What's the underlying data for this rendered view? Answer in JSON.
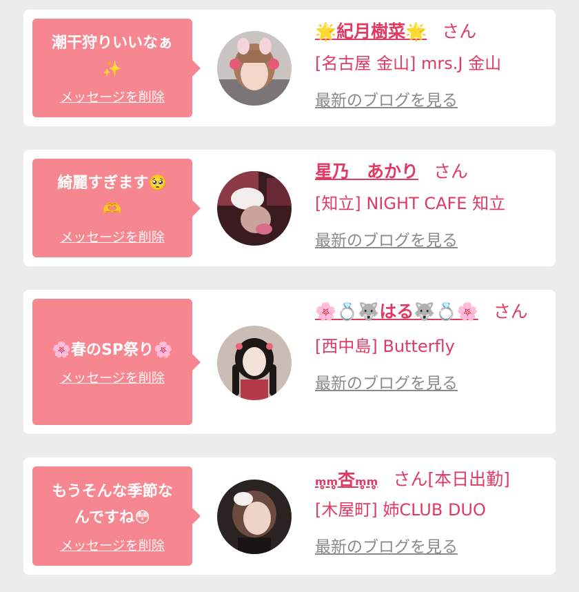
{
  "delete_label": "メッセージを削除",
  "blog_label": "最新のブログを見る",
  "honorific": "さん",
  "colors": {
    "accent": "#e03964",
    "bubble": "#f6868f",
    "background": "#ececec"
  },
  "cards": [
    {
      "message_line1": "潮干狩りいいなぁ",
      "message_line2": "✨",
      "name": "🌟紀月樹菜🌟",
      "status": "",
      "shop": "[名古屋 金山] mrs.J 金山"
    },
    {
      "message_line1": "綺麗すぎます🥺",
      "message_line2": "🫶",
      "name": "星乃　あかり",
      "status": "",
      "shop": "[知立] NIGHT CAFE 知立"
    },
    {
      "message_line1": "🌸春のSP祭り🌸",
      "message_line2": "",
      "name": "🌸💍🐺はる🐺💍🌸",
      "status": "",
      "shop": "[西中島] Butterfly"
    },
    {
      "message_line1": "もうそんな季節な",
      "message_line2": "んですね😳",
      "name": "ₘ̥ₘ̥杏ₘ̥ₘ̥",
      "status": "[本日出勤]",
      "shop": "[木屋町] 姉CLUB DUO"
    }
  ]
}
